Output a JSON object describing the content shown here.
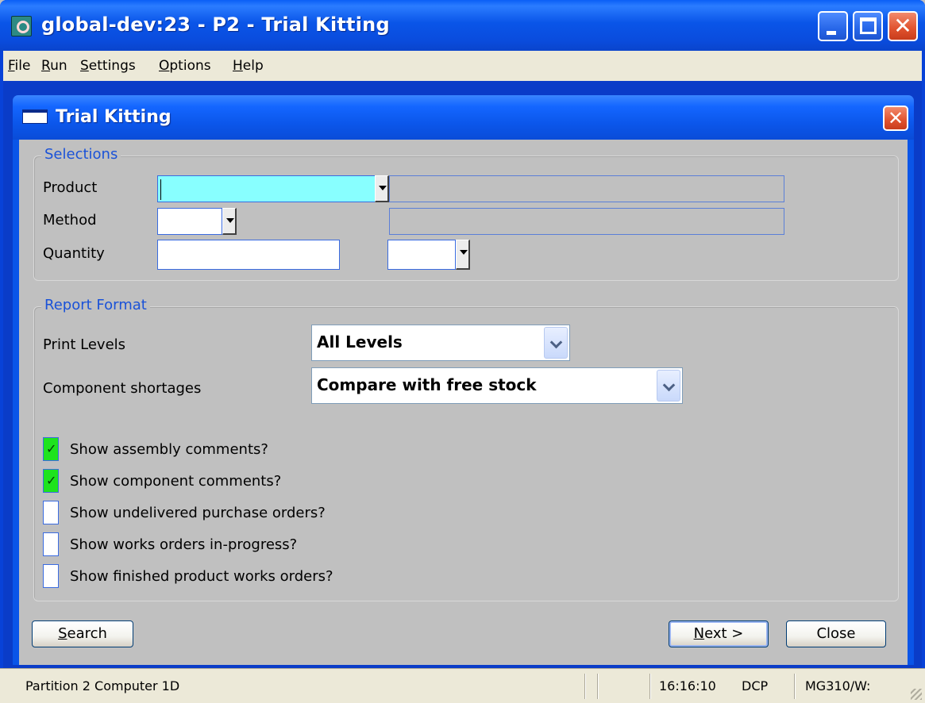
{
  "window": {
    "title": "global-dev:23 - P2 - Trial Kitting"
  },
  "menu": {
    "items": [
      {
        "label": "File",
        "accel": "F",
        "rest": "ile"
      },
      {
        "label": "Run",
        "accel": "R",
        "rest": "un"
      },
      {
        "label": "Settings",
        "accel": "S",
        "rest": "ettings"
      },
      {
        "label": "Options",
        "accel": "O",
        "rest": "ptions"
      },
      {
        "label": "Help",
        "accel": "H",
        "rest": "elp"
      }
    ]
  },
  "dialog": {
    "title": "Trial Kitting",
    "selections": {
      "legend": "Selections",
      "product_label": "Product",
      "product_value": "",
      "product_description": "",
      "method_label": "Method",
      "method_value": "",
      "method_description": "",
      "quantity_label": "Quantity",
      "quantity_value": "",
      "quantity_unit": ""
    },
    "report_format": {
      "legend": "Report Format",
      "print_levels_label": "Print Levels",
      "print_levels_value": "All Levels",
      "component_shortages_label": "Component shortages",
      "component_shortages_value": "Compare with free stock",
      "checkboxes": [
        {
          "label": "Show assembly comments?",
          "checked": true
        },
        {
          "label": "Show component comments?",
          "checked": true
        },
        {
          "label": "Show undelivered purchase orders?",
          "checked": false
        },
        {
          "label": "Show works orders in-progress?",
          "checked": false
        },
        {
          "label": "Show finished product works orders?",
          "checked": false
        }
      ]
    },
    "buttons": {
      "search": {
        "label": "Search",
        "accel": "S",
        "rest": "earch"
      },
      "next": {
        "label": "Next >",
        "accel": "N",
        "rest": "ext >"
      },
      "close": {
        "label": "Close"
      }
    }
  },
  "statusbar": {
    "partition": "Partition 2 Computer 1D",
    "time": "16:16:10",
    "user": "DCP",
    "program": "MG310/W:"
  },
  "colors": {
    "titlebar_blue": "#0a55e8",
    "required_field": "#88ffff",
    "checkbox_on": "#1ee31e",
    "legend_text": "#1a52d8"
  }
}
